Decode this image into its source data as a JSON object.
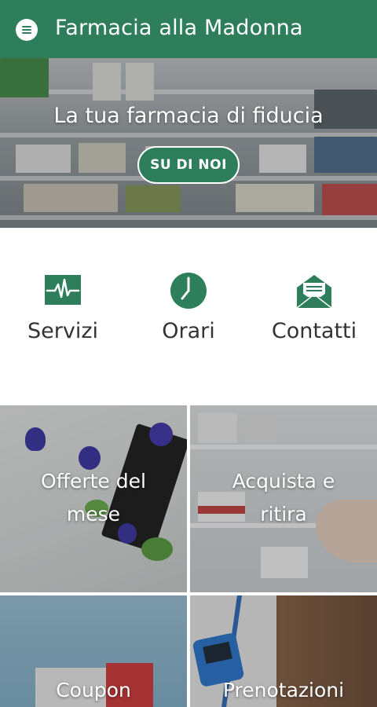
{
  "app_bar": {
    "title": "Farmacia alla Madonna",
    "menu_icon": "menu-icon",
    "color": "#2e7d5b"
  },
  "hero": {
    "headline": "La tua farmacia di fiducia",
    "button_label": "SU DI NOI"
  },
  "quick_links": [
    {
      "label": "Servizi",
      "icon": "heartbeat-icon"
    },
    {
      "label": "Orari",
      "icon": "clock-icon"
    },
    {
      "label": "Contatti",
      "icon": "envelope-icon"
    }
  ],
  "tiles": [
    {
      "label_line1": "Offerte del",
      "label_line2": "mese"
    },
    {
      "label_line1": "Acquista e",
      "label_line2": "ritira"
    },
    {
      "label_line1": "Coupon"
    },
    {
      "label_line1": "Prenotazioni"
    }
  ]
}
